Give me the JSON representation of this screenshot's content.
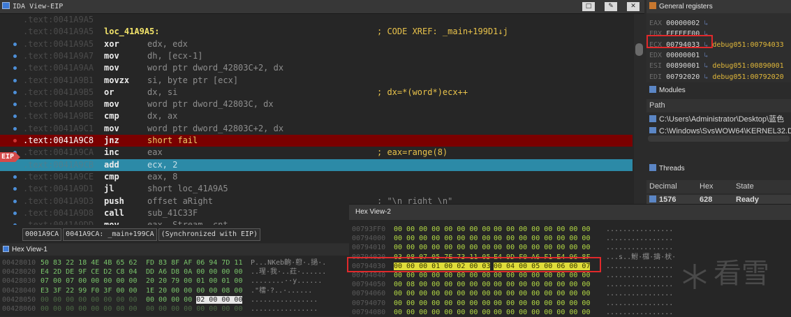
{
  "ida": {
    "title": "IDA View-EIP",
    "win_buttons": [
      "□",
      "✎",
      "✕"
    ],
    "eip_label": "EIP",
    "rows": [
      {
        "addr": ".text:0041A9A5",
        "mnem": "",
        "ops": "",
        "comment": "",
        "dot": false
      },
      {
        "addr": ".text:0041A9A5",
        "label": "loc_41A9A5:",
        "comment": "; CODE XREF: _main+199D1↓j",
        "dot": false
      },
      {
        "addr": ".text:0041A9A5",
        "mnem": "xor",
        "ops": "edx, edx",
        "comment": "",
        "dot": true
      },
      {
        "addr": ".text:0041A9A7",
        "mnem": "mov",
        "ops": "dh, [ecx-1]",
        "comment": "",
        "dot": true
      },
      {
        "addr": ".text:0041A9AA",
        "mnem": "mov",
        "ops": "word ptr dword_42803C+2, dx",
        "comment": "",
        "dot": true
      },
      {
        "addr": ".text:0041A9B1",
        "mnem": "movzx",
        "ops": "si, byte ptr [ecx]",
        "comment": "",
        "dot": true
      },
      {
        "addr": ".text:0041A9B5",
        "mnem": "or",
        "ops": "dx, si",
        "comment": "; dx=*(word*)ecx++",
        "dot": true
      },
      {
        "addr": ".text:0041A9B8",
        "mnem": "mov",
        "ops": "word ptr dword_42803C, dx",
        "comment": "",
        "dot": true
      },
      {
        "addr": ".text:0041A9BE",
        "mnem": "cmp",
        "ops": "dx, ax",
        "comment": "",
        "dot": true
      },
      {
        "addr": ".text:0041A9C1",
        "mnem": "mov",
        "ops": "word ptr dword_42803C+2, dx",
        "comment": "",
        "dot": true
      },
      {
        "addr": ".text:0041A9C8",
        "mnem": "jnz",
        "ops": "short fail",
        "comment": "",
        "dot": true,
        "state": "breakpoint"
      },
      {
        "addr": ".text:0041A9CA",
        "mnem": "inc",
        "ops": "eax",
        "comment": "; eax=range(8)",
        "dot": true
      },
      {
        "addr": ".text:0041A9CB",
        "mnem": "add",
        "ops": "ecx, 2",
        "comment": "",
        "dot": false,
        "state": "current"
      },
      {
        "addr": ".text:0041A9CE",
        "mnem": "cmp",
        "ops": "eax, 8",
        "comment": "",
        "dot": true
      },
      {
        "addr": ".text:0041A9D1",
        "mnem": "jl",
        "ops": "short loc_41A9A5",
        "comment": "",
        "dot": true
      },
      {
        "addr": ".text:0041A9D3",
        "mnem": "push",
        "ops": "offset aRight",
        "comment": "; \"\\n right \\n\"",
        "dot": true
      },
      {
        "addr": ".text:0041A9D8",
        "mnem": "call",
        "ops": "sub_41C33F",
        "comment": "",
        "dot": true
      },
      {
        "addr": ".text:0041A9DD",
        "mnem": "mov",
        "ops": "eax, Stream._cnt",
        "comment": "",
        "dot": true
      }
    ],
    "status": [
      "0001A9CA",
      "0041A9CA: _main+199CA",
      "(Synchronized with EIP)"
    ]
  },
  "registers": {
    "title": "General registers",
    "items": [
      {
        "name": "EAX",
        "value": "00000002",
        "link": ""
      },
      {
        "name": "EBX",
        "value": "FFFEEF00",
        "link": ""
      },
      {
        "name": "ECX",
        "value": "00794033",
        "link": "debug051:00794033"
      },
      {
        "name": "EDX",
        "value": "00000001",
        "link": ""
      },
      {
        "name": "ESI",
        "value": "00890001",
        "link": "debug051:00890001"
      },
      {
        "name": "EDI",
        "value": "00792020",
        "link": "debug051:00792020"
      }
    ]
  },
  "modules": {
    "title": "Modules",
    "col_path": "Path",
    "rows": [
      "C:\\Users\\Administrator\\Desktop\\蓝色",
      "C:\\Windows\\SysWOW64\\KERNEL32.D"
    ]
  },
  "threads": {
    "title": "Threads",
    "cols": [
      "Decimal",
      "Hex",
      "State"
    ],
    "row": {
      "decimal": "1576",
      "hex": "628",
      "state": "Ready"
    }
  },
  "hex1": {
    "title": "Hex View-1",
    "rows": [
      {
        "addr": "00428010",
        "b1": "50 83 22 18 4E 4B 65 62",
        "b2": "FD 83 8F AF 06 94 7D 11",
        "ascii": "P...NKeb齣·藯·.撾·."
      },
      {
        "addr": "00428020",
        "b1": "E4 2D DE 9F CE D2 C8 04",
        "b2": "DD A6 D8 0A 00 00 00 00",
        "ascii": "..瑆·我·..荭·......"
      },
      {
        "addr": "00428030",
        "b1": "07 00 07 00 00 00 00 00",
        "b2": "20 20 79 00 01 00 01 00",
        "ascii": "........··y......"
      },
      {
        "addr": "00428040",
        "b1": "E3 3F 22 99 F0 3F 00 00",
        "b2": "1E 20 00 00 00 00 08 00",
        "ascii": ".\"檑·?..·......"
      },
      {
        "addr": "00428050",
        "b1": "00 00 00 00 00 00 00 00",
        "b2": "00 00 00 00 02 00 00 00",
        "ascii": "................"
      },
      {
        "addr": "00428060",
        "b1": "00 00 00 00 00 00 00 00",
        "b2": "00 00 00 00 00 00 00 00",
        "ascii": "................"
      }
    ]
  },
  "hex2": {
    "title": "Hex View-2",
    "rows": [
      {
        "addr": "00793FF0",
        "b1": "00 00 00 00 00 00 00 00",
        "b2": "00 00 00 00 00 00 00 00",
        "ascii": "................"
      },
      {
        "addr": "00794000",
        "b1": "00 00 00 00 00 00 00 00",
        "b2": "00 00 00 00 00 00 00 00",
        "ascii": "................"
      },
      {
        "addr": "00794010",
        "b1": "00 00 00 00 00 00 00 00",
        "b2": "00 00 00 00 00 00 00 00",
        "ascii": "................"
      },
      {
        "addr": "00794020",
        "b1": "03 08 07 05 7E 73 11 05",
        "b2": "E4 9D F0 A6 F1 E4 96 8F",
        "ascii": "...s..鮒·欏·擣·枤·"
      },
      {
        "addr": "00794030",
        "b1": "00 00 00 01 00 02 00 03",
        "b2": "00 04 00 05 00 06 00 07",
        "ascii": "................",
        "selected": true
      },
      {
        "addr": "00794040",
        "b1": "00 00 00 00 00 00 00 00",
        "b2": "00 00 00 00 00 00 00 00",
        "ascii": "................"
      },
      {
        "addr": "00794050",
        "b1": "00 08 00 00 00 00 00 00",
        "b2": "00 00 00 00 00 00 00 00",
        "ascii": "................"
      },
      {
        "addr": "00794060",
        "b1": "00 00 00 00 00 00 00 00",
        "b2": "00 00 00 00 00 00 00 00",
        "ascii": "................"
      },
      {
        "addr": "00794070",
        "b1": "00 00 00 00 00 00 00 00",
        "b2": "00 00 00 00 00 00 00 00",
        "ascii": "................"
      },
      {
        "addr": "00794080",
        "b1": "00 00 00 00 00 00 00 00",
        "b2": "00 00 00 00 00 00 00 00",
        "ascii": "................"
      }
    ]
  },
  "watermark": "看雪",
  "colors": {
    "breakpoint": "#7a0000",
    "current": "#2c8aa7",
    "highlight": "#e0dd3a",
    "annotation": "#e0292b"
  }
}
